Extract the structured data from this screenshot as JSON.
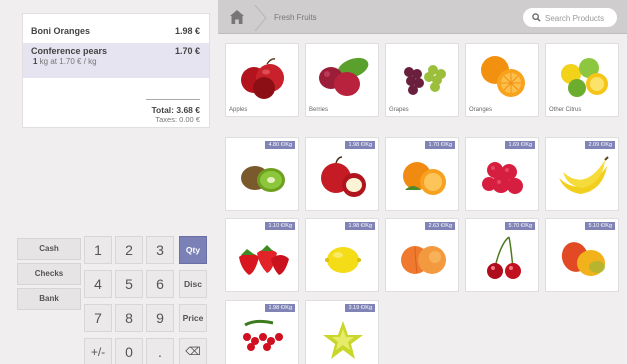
{
  "order": {
    "lines": [
      {
        "name": "Boni Oranges",
        "price": "1.98 €"
      },
      {
        "name": "Conference pears",
        "price": "1.70 €",
        "qty": "1",
        "unit_info": " kg at 1.70 € / kg"
      }
    ],
    "total": "Total: 3.68 €",
    "taxes": "Taxes: 0.00 €"
  },
  "payment_methods": [
    "Cash",
    "Checks",
    "Bank"
  ],
  "numpad": {
    "rows": [
      [
        "1",
        "2",
        "3",
        "Qty"
      ],
      [
        "4",
        "5",
        "6",
        "Disc"
      ],
      [
        "7",
        "8",
        "9",
        "Price"
      ],
      [
        "+/-",
        "0",
        ".",
        "⌫"
      ]
    ],
    "selected_mode": "Qty"
  },
  "breadcrumb": {
    "category": "Fresh Fruits"
  },
  "search": {
    "placeholder": "Search Products"
  },
  "categories": [
    "Apples",
    "Berries",
    "Grapes",
    "Oranges",
    "Other Citrus"
  ],
  "products": [
    {
      "icon": "kiwi-icon",
      "price": "4.80 €/Kg"
    },
    {
      "icon": "red-apples-icon",
      "price": "1.98 €/Kg"
    },
    {
      "icon": "oranges-icon",
      "price": "1.70 €/Kg"
    },
    {
      "icon": "raspberries-icon",
      "price": "1.69 €/Kg"
    },
    {
      "icon": "bananas-icon",
      "price": "2.09 €/Kg"
    },
    {
      "icon": "strawberries-icon",
      "price": "1.10 €/Kg"
    },
    {
      "icon": "lemon-icon",
      "price": "1.98 €/Kg"
    },
    {
      "icon": "peaches-icon",
      "price": "2.63 €/Kg"
    },
    {
      "icon": "cherries-icon",
      "price": "5.70 €/Kg"
    },
    {
      "icon": "mangoes-icon",
      "price": "5.10 €/Kg"
    },
    {
      "icon": "redcurrants-icon",
      "price": "1.98 €/Kg"
    },
    {
      "icon": "starfruit-icon",
      "price": "3.19 €/Kg"
    }
  ],
  "colors": {
    "accent": "#7b80b6",
    "price_badge": "#7f83b6",
    "selected_line": "#e6e4f0"
  }
}
